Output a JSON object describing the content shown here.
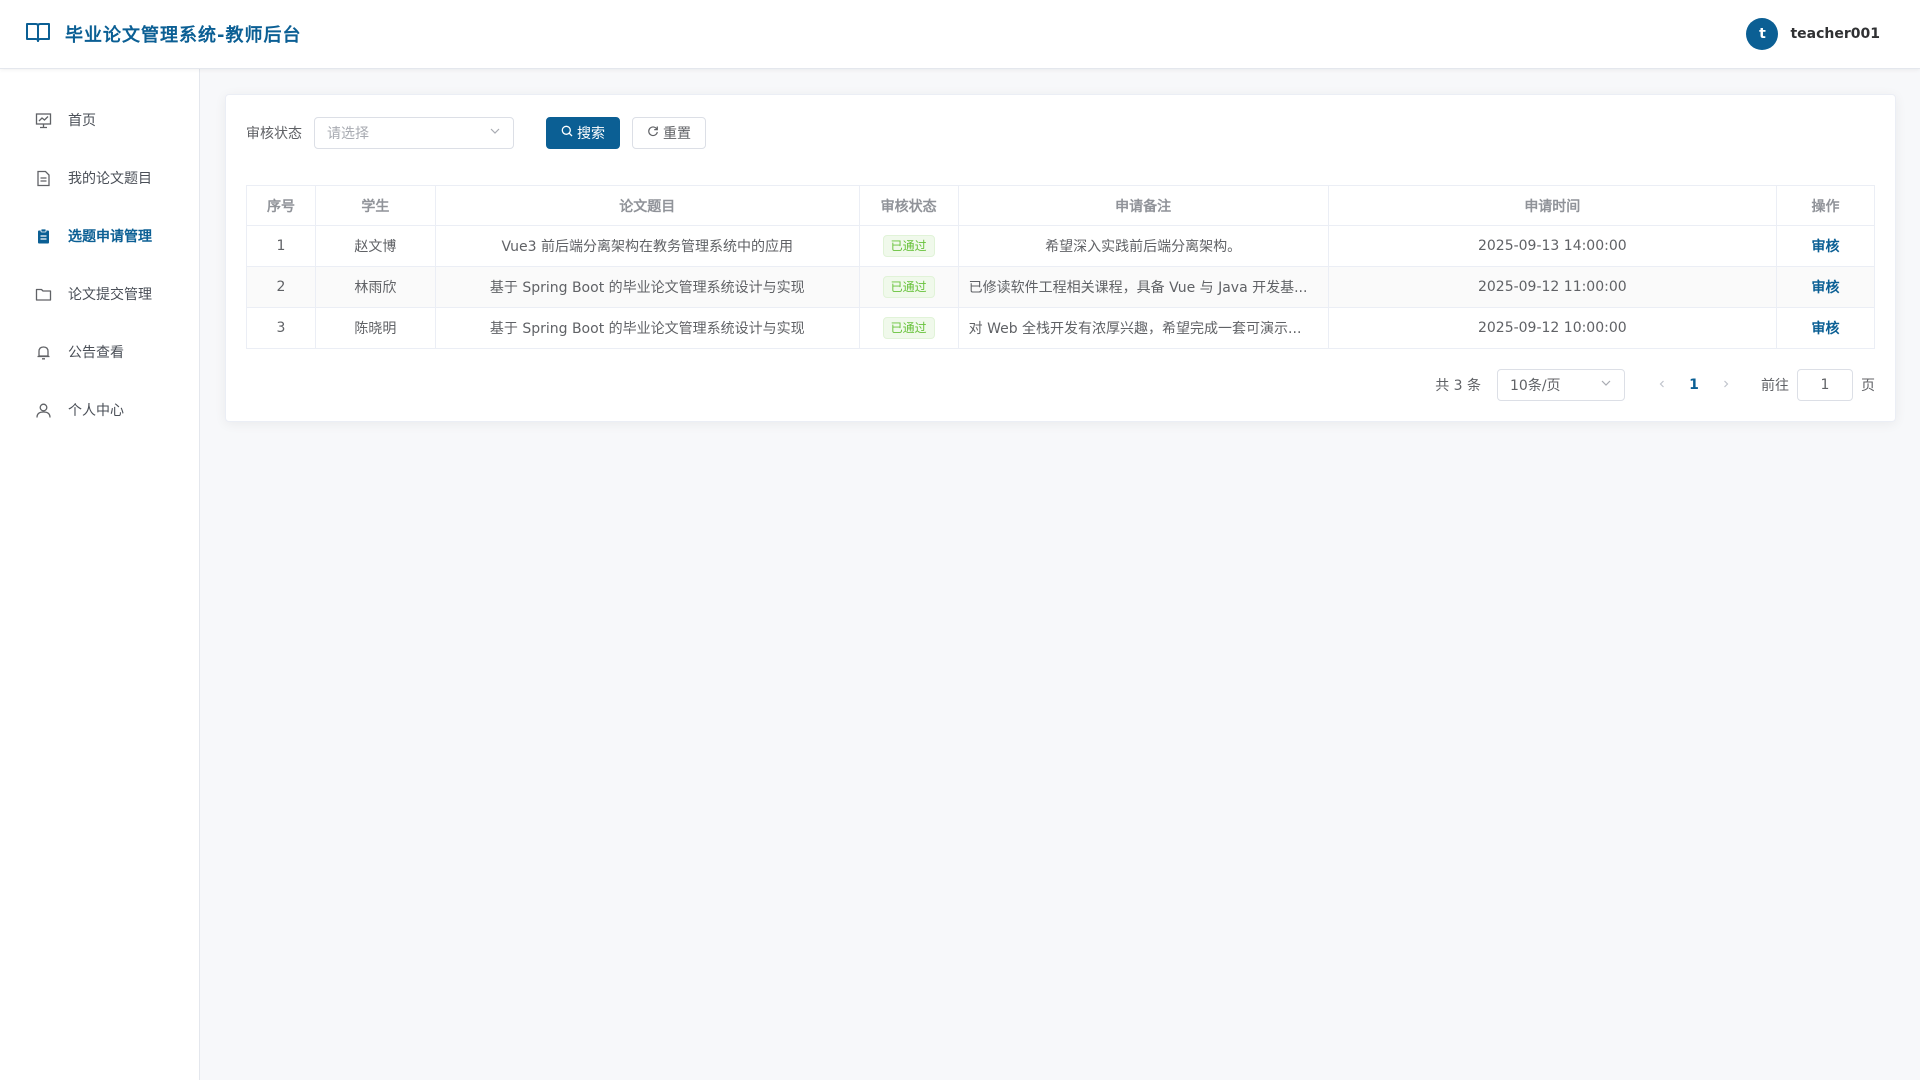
{
  "header": {
    "title": "毕业论文管理系统-教师后台",
    "avatar_letter": "t",
    "username": "teacher001"
  },
  "sidebar": {
    "items": [
      {
        "label": "首页",
        "icon": "dashboard-icon"
      },
      {
        "label": "我的论文题目",
        "icon": "document-icon"
      },
      {
        "label": "选题申请管理",
        "icon": "clipboard-icon",
        "active": true
      },
      {
        "label": "论文提交管理",
        "icon": "folder-icon"
      },
      {
        "label": "公告查看",
        "icon": "bell-icon"
      },
      {
        "label": "个人中心",
        "icon": "user-icon"
      }
    ]
  },
  "filter": {
    "label": "审核状态",
    "select_placeholder": "请选择",
    "search_label": "搜索",
    "reset_label": "重置"
  },
  "table": {
    "columns": [
      "序号",
      "学生",
      "论文题目",
      "审核状态",
      "申请备注",
      "申请时间",
      "操作"
    ],
    "rows": [
      {
        "index": "1",
        "student": "赵文博",
        "title": "Vue3 前后端分离架构在教务管理系统中的应用",
        "status": "已通过",
        "remark": "希望深入实践前后端分离架构。",
        "time": "2025-09-13 14:00:00",
        "action": "审核"
      },
      {
        "index": "2",
        "student": "林雨欣",
        "title": "基于 Spring Boot 的毕业论文管理系统设计与实现",
        "status": "已通过",
        "remark": "已修读软件工程相关课程，具备 Vue 与 Java 开发基...",
        "time": "2025-09-12 11:00:00",
        "action": "审核"
      },
      {
        "index": "3",
        "student": "陈晓明",
        "title": "基于 Spring Boot 的毕业论文管理系统设计与实现",
        "status": "已通过",
        "remark": "对 Web 全栈开发有浓厚兴趣，希望完成一套可演示...",
        "time": "2025-09-12 10:00:00",
        "action": "审核"
      }
    ]
  },
  "pagination": {
    "total_text": "共 3 条",
    "page_size": "10条/页",
    "current_page": "1",
    "goto_label": "前往",
    "goto_value": "1",
    "page_suffix": "页"
  },
  "colors": {
    "primary": "#0b5f94",
    "success": "#67c23a",
    "background": "#f7f8fa"
  }
}
